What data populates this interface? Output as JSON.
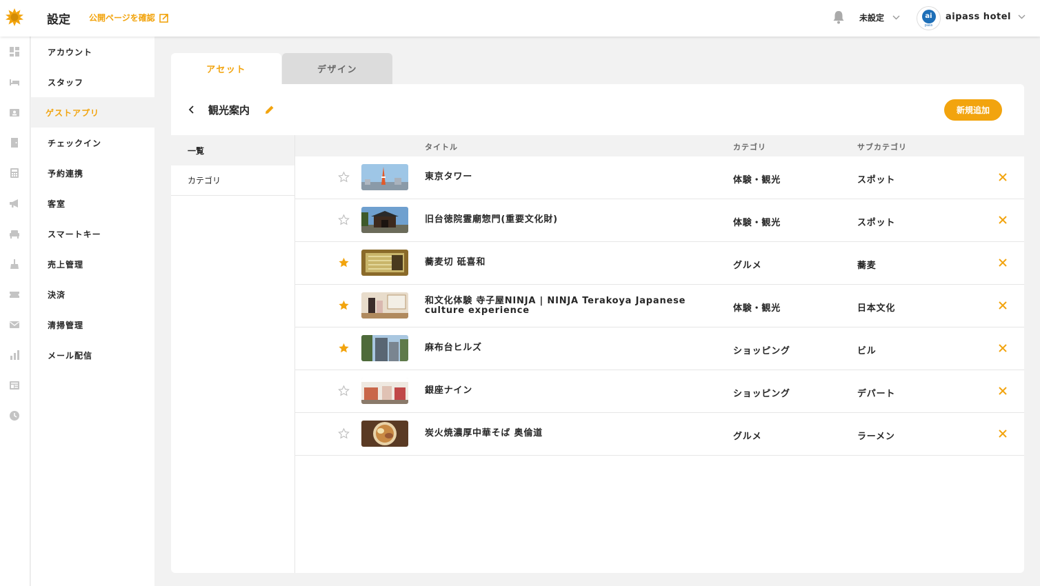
{
  "header": {
    "title": "設定",
    "public_link": "公開ページを確認",
    "status": "未設定",
    "avatar_text": "ai",
    "avatar_sub": "pass",
    "hotel": "aipass hotel"
  },
  "rail_icons": [
    "dashboard-icon",
    "bed-icon",
    "contact-card-icon",
    "door-icon",
    "calculator-icon",
    "megaphone-icon",
    "armchair-icon",
    "cleaning-icon",
    "ticket-icon",
    "mail-icon",
    "bar-chart-icon",
    "article-icon",
    "clock-icon"
  ],
  "menu": {
    "items": [
      {
        "label": "アカウント"
      },
      {
        "label": "スタッフ"
      },
      {
        "label": "ゲストアプリ"
      },
      {
        "label": "チェックイン"
      },
      {
        "label": "予約連携"
      },
      {
        "label": "客室"
      },
      {
        "label": "スマートキー"
      },
      {
        "label": "売上管理"
      },
      {
        "label": "決済"
      },
      {
        "label": "清掃管理"
      },
      {
        "label": "メール配信"
      }
    ],
    "active_index": 2
  },
  "tabs": [
    {
      "label": "アセット",
      "active": true
    },
    {
      "label": "デザイン",
      "active": false
    }
  ],
  "card": {
    "title": "観光案内",
    "add_label": "新規追加"
  },
  "subnav": [
    {
      "label": "一覧"
    },
    {
      "label": "カテゴリ"
    }
  ],
  "table": {
    "headers": {
      "title": "タイトル",
      "category": "カテゴリ",
      "subcategory": "サブカテゴリ"
    },
    "rows": [
      {
        "title": "東京タワー",
        "category": "体験・観光",
        "subcategory": "スポット",
        "favorite": false
      },
      {
        "title": "旧台徳院霊廟惣門(重要文化財)",
        "category": "体験・観光",
        "subcategory": "スポット",
        "favorite": false
      },
      {
        "title": "蕎麦切 砥喜和",
        "category": "グルメ",
        "subcategory": "蕎麦",
        "favorite": true
      },
      {
        "title": "和文化体験 寺子屋NINJA | NINJA Terakoya Japanese culture experience",
        "category": "体験・観光",
        "subcategory": "日本文化",
        "favorite": true
      },
      {
        "title": "麻布台ヒルズ",
        "category": "ショッピング",
        "subcategory": "ビル",
        "favorite": true
      },
      {
        "title": "銀座ナイン",
        "category": "ショッピング",
        "subcategory": "デパート",
        "favorite": false
      },
      {
        "title": "炭火焼濃厚中華そば 奥倫道",
        "category": "グルメ",
        "subcategory": "ラーメン",
        "favorite": false
      }
    ]
  },
  "colors": {
    "accent": "#f2a40e",
    "text": "#272727",
    "muted": "#676767",
    "bg": "#f2f2f2"
  }
}
